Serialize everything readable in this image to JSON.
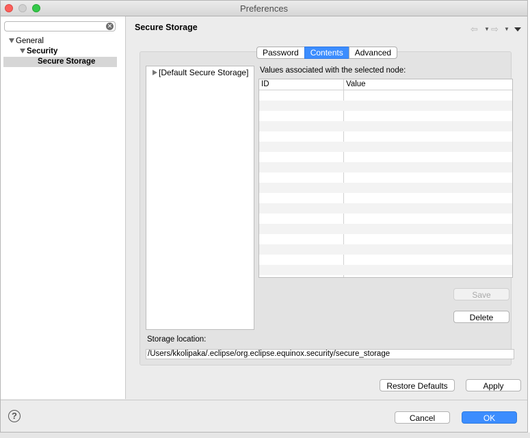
{
  "window": {
    "title": "Preferences"
  },
  "sidebar": {
    "filter": {
      "value": "",
      "placeholder": ""
    },
    "tree": [
      {
        "label": "General"
      },
      {
        "label": "Security"
      },
      {
        "label": "Secure Storage",
        "selected": true
      }
    ]
  },
  "page": {
    "title": "Secure Storage"
  },
  "tabs": [
    {
      "label": "Password"
    },
    {
      "label": "Contents",
      "active": true
    },
    {
      "label": "Advanced"
    }
  ],
  "contents": {
    "node": "[Default Secure Storage]",
    "values_label": "Values associated with the selected node:",
    "columns": [
      "ID",
      "Value"
    ],
    "save_label": "Save",
    "delete_label": "Delete",
    "storage_location_label": "Storage location:",
    "storage_location": "/Users/kkolipaka/.eclipse/org.eclipse.equinox.security/secure_storage"
  },
  "buttons": {
    "restore_defaults": "Restore Defaults",
    "apply": "Apply",
    "cancel": "Cancel",
    "ok": "OK",
    "help": "?"
  },
  "colors": {
    "accent": "#3c8dfe"
  }
}
